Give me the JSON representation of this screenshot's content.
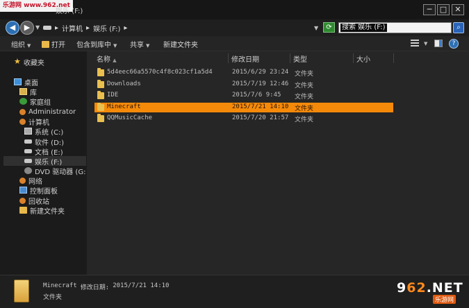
{
  "window": {
    "title": "娱乐 (F:)",
    "watermark": "乐游网 www.962.net",
    "buttons": {
      "minimize": "─",
      "maximize": "□",
      "close": "✕"
    }
  },
  "address": {
    "breadcrumbs": [
      "计算机",
      "娱乐 (F:)"
    ],
    "separator": "▸",
    "search_value": "搜索 娱乐 (F:)"
  },
  "toolbar": {
    "organize": "组织",
    "open": "打开",
    "include_in_library": "包含到库中",
    "share": "共享",
    "new_folder": "新建文件夹"
  },
  "sidebar": {
    "favorites": "收藏夹",
    "desktop": "桌面",
    "library": "库",
    "homegroup": "家庭组",
    "administrator": "Administrator",
    "computer": "计算机",
    "drive_c": "系统 (C:)",
    "drive_d": "软件 (D:)",
    "drive_e": "文档 (E:)",
    "drive_f": "娱乐 (F:)",
    "drive_g": "DVD 驱动器 (G:",
    "network": "网络",
    "control_panel": "控制面板",
    "recycle_bin": "回收站",
    "new_folder": "新建文件夹"
  },
  "columns": {
    "name": "名称",
    "sort_arrow": "▲",
    "modified": "修改日期",
    "type": "类型",
    "size": "大小"
  },
  "files": [
    {
      "name": "5d4eec66a5570c4f8c023cf1a5d4",
      "modified": "2015/6/29 23:24",
      "type": "文件夹"
    },
    {
      "name": "Downloads",
      "modified": "2015/7/19 12:46",
      "type": "文件夹"
    },
    {
      "name": "IDE",
      "modified": "2015/7/6 9:45",
      "type": "文件夹"
    },
    {
      "name": "Minecraft",
      "modified": "2015/7/21 14:10",
      "type": "文件夹"
    },
    {
      "name": "QQMusicCache",
      "modified": "2015/7/20 21:57",
      "type": "文件夹"
    }
  ],
  "selected_file_index": 3,
  "details": {
    "name": "Minecraft",
    "modified_label": "修改日期:",
    "modified_value": "2015/7/21 14:10",
    "type": "文件夹"
  },
  "logo": {
    "main_prefix": "9",
    "main_accent": "62",
    "main_suffix": ".NET",
    "sub": "乐游网"
  },
  "colors": {
    "selection": "#f58a0a",
    "background": "#262626",
    "sidebar": "#1b1b1b",
    "folder": "#e9bf4f"
  }
}
